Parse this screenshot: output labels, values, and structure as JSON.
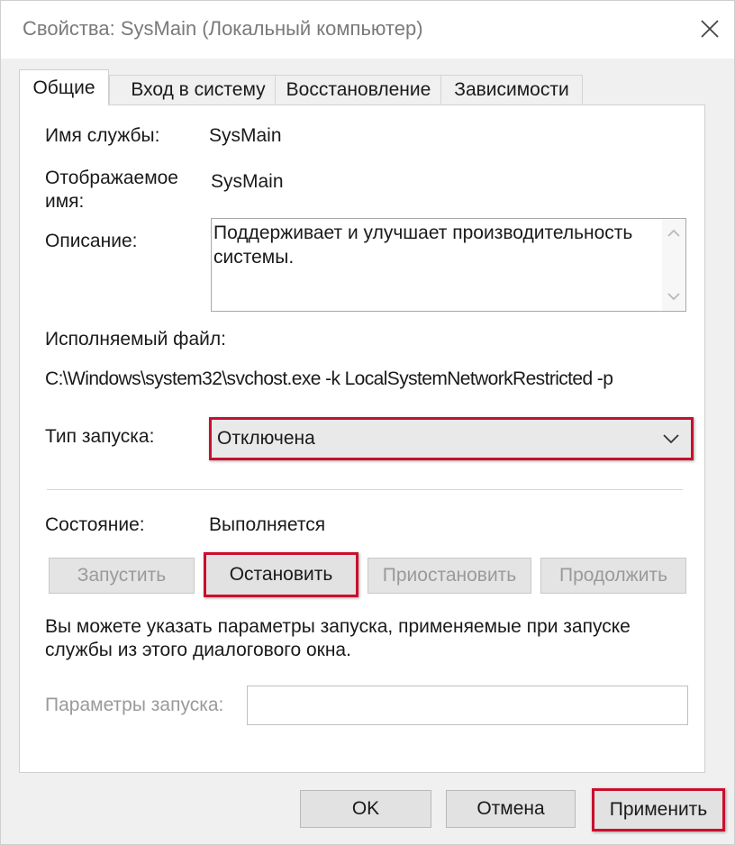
{
  "window": {
    "title": "Свойства: SysMain (Локальный компьютер)"
  },
  "tabs": [
    {
      "label": "Общие",
      "active": true
    },
    {
      "label": "Вход в систему",
      "active": false
    },
    {
      "label": "Восстановление",
      "active": false
    },
    {
      "label": "Зависимости",
      "active": false
    }
  ],
  "general": {
    "service_name_label": "Имя службы:",
    "service_name_value": "SysMain",
    "display_name_label": "Отображаемое имя:",
    "display_name_value": "SysMain",
    "description_label": "Описание:",
    "description_value": "Поддерживает и улучшает производительность системы.",
    "exec_label": "Исполняемый файл:",
    "exec_value": "C:\\Windows\\system32\\svchost.exe -k LocalSystemNetworkRestricted -p",
    "startup_type_label": "Тип запуска:",
    "startup_type_value": "Отключена",
    "status_label": "Состояние:",
    "status_value": "Выполняется",
    "start_button": "Запустить",
    "stop_button": "Остановить",
    "pause_button": "Приостановить",
    "resume_button": "Продолжить",
    "hint": "Вы можете указать параметры запуска, применяемые при запуске службы из этого диалогового окна.",
    "params_label": "Параметры запуска:",
    "params_value": ""
  },
  "footer": {
    "ok": "OK",
    "cancel": "Отмена",
    "apply": "Применить"
  },
  "colors": {
    "highlight": "#c8102e",
    "disabled_text": "#9a9a9a"
  },
  "icons": {
    "close": "close-icon",
    "dropdown": "chevron-down-icon",
    "scroll_up": "scroll-up-icon",
    "scroll_down": "scroll-down-icon"
  }
}
